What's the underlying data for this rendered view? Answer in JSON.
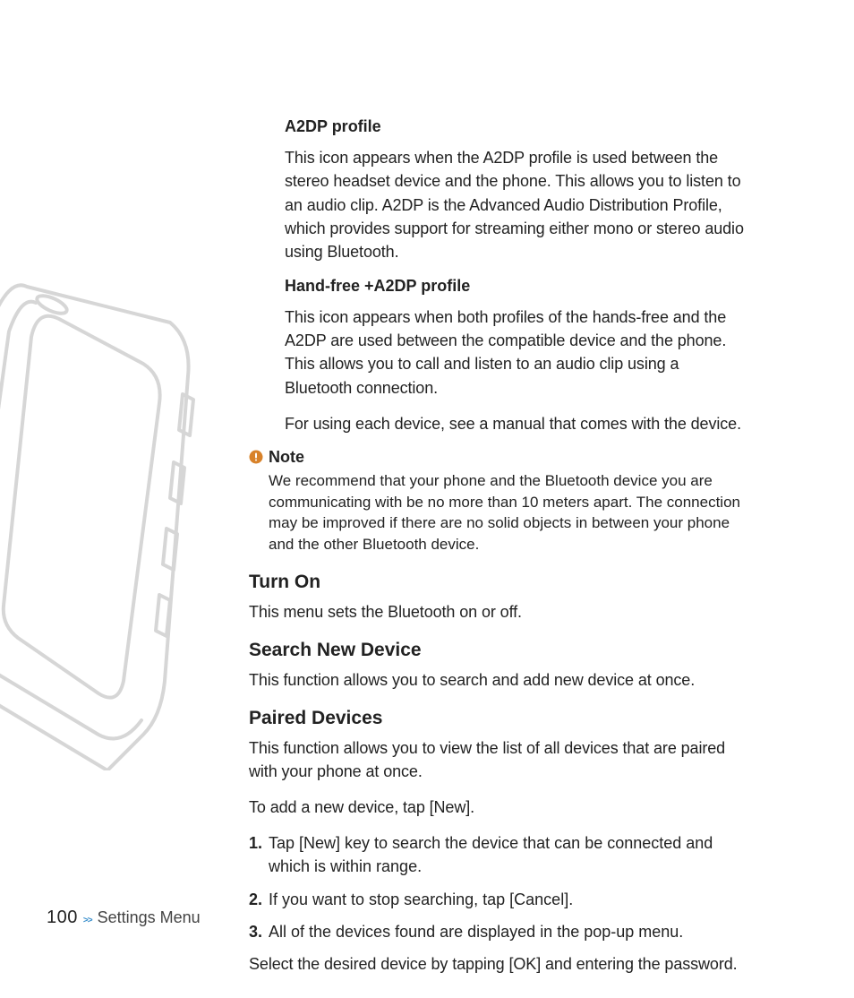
{
  "footer": {
    "page_number": "100",
    "chevrons": ">>",
    "section": "Settings Menu"
  },
  "sections": {
    "a2dp": {
      "heading": "A2DP profile",
      "body": "This icon appears when the A2DP profile is used between the stereo headset device and the phone. This allows you to listen to an audio clip. A2DP is the  Advanced Audio Distribution Profile, which provides support for streaming either mono or stereo audio using Bluetooth."
    },
    "handfree": {
      "heading": "Hand-free +A2DP profile",
      "body1": "This icon appears when both profiles of the hands-free and the A2DP are used between the compatible device and the phone. This allows you to call and listen to an audio clip using a Bluetooth connection.",
      "body2": "For using each device, see a manual that comes with the device."
    },
    "note": {
      "title": "Note",
      "body": "We recommend that your phone and the Bluetooth device you are communicating with be no more than 10 meters apart. The connection may be improved if there are no solid objects in between your phone and the other Bluetooth device."
    },
    "turn_on": {
      "heading": "Turn On",
      "body": "This menu sets the Bluetooth on or off."
    },
    "search": {
      "heading": "Search New Device",
      "body": "This function allows you to search and add new device at once."
    },
    "paired": {
      "heading": "Paired Devices",
      "body1": "This function allows you to view the list of all devices that are paired with your phone at once.",
      "body2": "To add a new device, tap [New].",
      "steps": [
        {
          "num": "1.",
          "txt": "Tap [New] key to search the device that can be connected and which is within range."
        },
        {
          "num": "2.",
          "txt": "If you want to stop searching, tap [Cancel]."
        },
        {
          "num": "3.",
          "txt": "All of the devices found are displayed in the pop-up menu."
        }
      ],
      "body3": "Select the desired device by tapping [OK] and entering the password."
    }
  }
}
